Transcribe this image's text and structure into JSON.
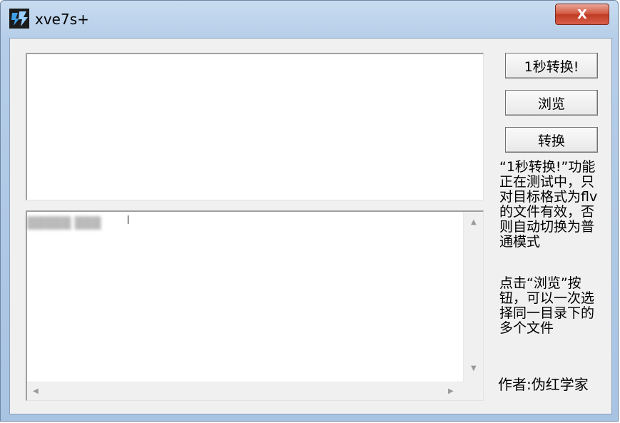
{
  "window": {
    "title": "xve7s+",
    "close_label": "X"
  },
  "buttons": {
    "one_second_convert": "1秒转换!",
    "browse": "浏览",
    "convert": "转换"
  },
  "notes": {
    "note1": "“1秒转换!”功能正在测试中，只对目标格式为flv的文件有效，否则自动切换为普通模式",
    "note2": "点击“浏览”按钮，可以一次选择同一目录下的多个文件"
  },
  "author": "作者:伪红学家",
  "text_areas": {
    "top_value": "",
    "bottom_value": "▒▒▒▒▒ ▒▒▒"
  }
}
